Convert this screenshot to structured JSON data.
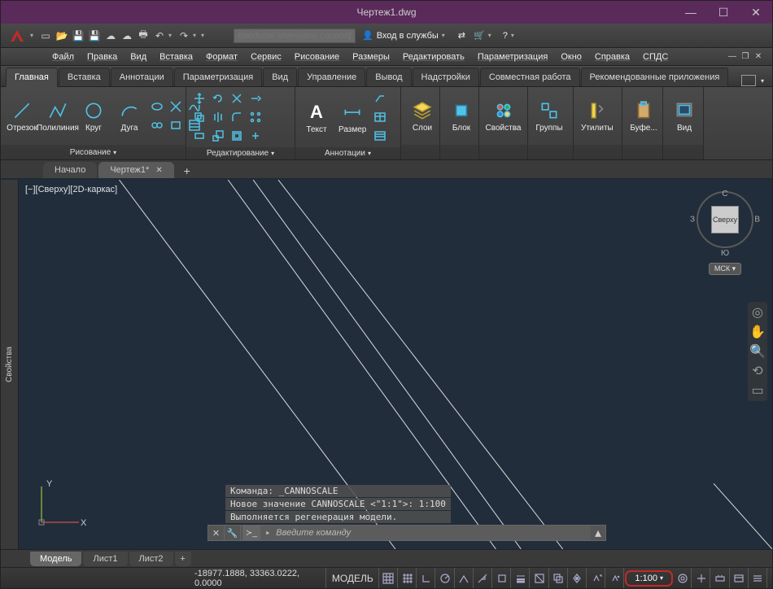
{
  "title": "Чертеж1.dwg",
  "search_placeholder": "Введите ключевое слово/фразу",
  "signin": "Вход в службы",
  "window_buttons": {
    "min": "—",
    "max": "☐",
    "close": "✕"
  },
  "menus": [
    "Файл",
    "Правка",
    "Вид",
    "Вставка",
    "Формат",
    "Сервис",
    "Рисование",
    "Размеры",
    "Редактировать",
    "Параметризация",
    "Окно",
    "Справка",
    "СПДС"
  ],
  "ribbon_tabs": [
    "Главная",
    "Вставка",
    "Аннотации",
    "Параметризация",
    "Вид",
    "Управление",
    "Вывод",
    "Надстройки",
    "Совместная работа",
    "Рекомендованные приложения"
  ],
  "ribbon_active": 0,
  "panels": {
    "draw": {
      "label": "Рисование",
      "buttons": [
        "Отрезок",
        "Полилиния",
        "Круг",
        "Дуга"
      ]
    },
    "modify": {
      "label": "Редактирование"
    },
    "annot": {
      "label": "Аннотации",
      "buttons": [
        "Текст",
        "Размер"
      ]
    },
    "layers": {
      "label": "Слои"
    },
    "block": {
      "label": "Блок"
    },
    "props": {
      "label": "Свойства"
    },
    "groups": {
      "label": "Группы"
    },
    "utils": {
      "label": "Утилиты"
    },
    "clip": {
      "label": "Буфе..."
    },
    "view": {
      "label": "Вид"
    }
  },
  "file_tabs": [
    {
      "label": "Начало"
    },
    {
      "label": "Чертеж1*",
      "active": true
    }
  ],
  "sidepanel": "Свойства",
  "viewport_label": "[−][Сверху][2D-каркас]",
  "viewcube": {
    "face": "Сверху",
    "n": "С",
    "s": "Ю",
    "e": "В",
    "w": "З",
    "msk": "МСК"
  },
  "ucs": {
    "x": "X",
    "y": "Y"
  },
  "cmd_history": [
    "Команда: _CANNOSCALE",
    "Новое значение CANNOSCALE <\"1:1\">: 1:100",
    "Выполняется регенерация модели."
  ],
  "cmd_placeholder": "Введите команду",
  "layout_tabs": [
    "Модель",
    "Лист1",
    "Лист2"
  ],
  "status": {
    "coords": "-18977.1888, 33363.0222, 0.0000",
    "space": "МОДЕЛЬ",
    "annoscale": "1:100"
  }
}
